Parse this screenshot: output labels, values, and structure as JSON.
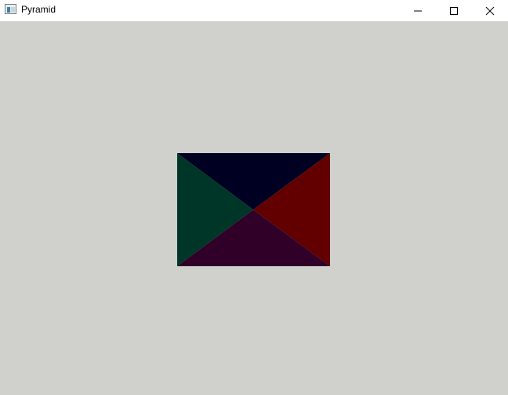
{
  "window": {
    "title": "Pyramid"
  },
  "title_bar": {
    "app_icon": "window-app-icon",
    "controls": [
      {
        "name": "minimize",
        "icon": "minimize-icon"
      },
      {
        "name": "maximize",
        "icon": "maximize-icon"
      },
      {
        "name": "close",
        "icon": "close-icon"
      }
    ]
  },
  "canvas": {
    "background": "#d0d0cc",
    "pyramid_faces": [
      {
        "face": "top",
        "color": "#000022"
      },
      {
        "face": "right",
        "color": "#620000"
      },
      {
        "face": "bottom",
        "color": "#300028"
      },
      {
        "face": "left",
        "color": "#003628"
      }
    ]
  }
}
